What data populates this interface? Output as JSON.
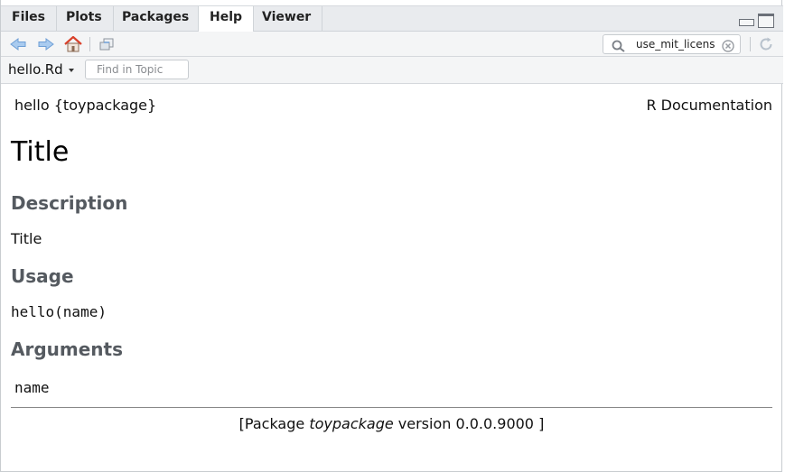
{
  "tabs": [
    {
      "label": "Files"
    },
    {
      "label": "Plots"
    },
    {
      "label": "Packages"
    },
    {
      "label": "Help"
    },
    {
      "label": "Viewer"
    }
  ],
  "active_tab": "Help",
  "toolbar": {
    "search_value": "use_mit_licens",
    "icons": [
      "back-arrow-icon",
      "forward-arrow-icon",
      "home-icon",
      "print-icon",
      "search-icon",
      "clear-icon",
      "refresh-icon"
    ]
  },
  "topic": {
    "file": "hello.Rd",
    "find_placeholder": "Find in Topic"
  },
  "doc": {
    "header_left": "hello {toypackage}",
    "header_right": "R Documentation",
    "title": "Title",
    "sections": {
      "description_heading": "Description",
      "description_text": "Title",
      "usage_heading": "Usage",
      "usage_code": "hello(name)",
      "arguments_heading": "Arguments",
      "argument_name": "name"
    },
    "footer": {
      "open": "[Package ",
      "package": "toypackage",
      "version": " version 0.0.0.9000 ]"
    }
  },
  "colors": {
    "accent_home": "#d9412b",
    "arrow_blue": "#7fb1e6",
    "heading_gray": "#555a60"
  }
}
